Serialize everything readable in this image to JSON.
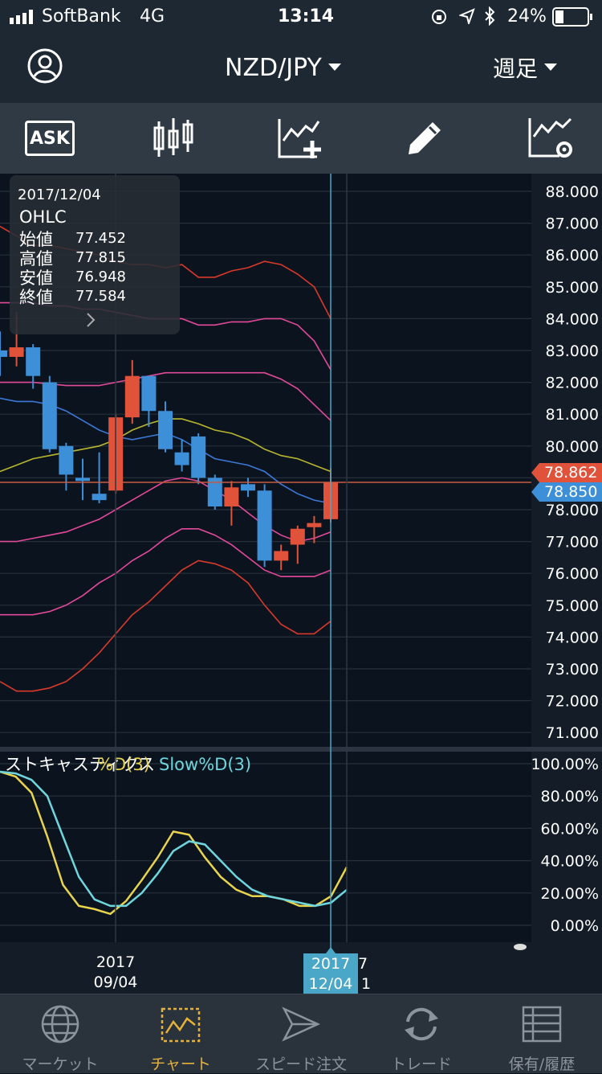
{
  "status_bar": {
    "carrier": "SoftBank",
    "network": "4G",
    "time": "13:14",
    "battery": "24%"
  },
  "header": {
    "pair": "NZD/JPY",
    "timeframe": "週足",
    "profile_icon": "user-circle-icon"
  },
  "toolbar": {
    "ask_label": "ASK",
    "icons": [
      "candlestick-icon",
      "add-indicator-icon",
      "pencil-icon",
      "indicator-settings-icon"
    ]
  },
  "ohlc_panel": {
    "date": "2017/12/04",
    "heading": "OHLC",
    "rows": [
      {
        "label": "始値",
        "value": "77.452"
      },
      {
        "label": "高値",
        "value": "77.815"
      },
      {
        "label": "安値",
        "value": "76.948"
      },
      {
        "label": "終値",
        "value": "77.584"
      }
    ]
  },
  "price_axis": [
    "88.000",
    "87.000",
    "86.000",
    "85.000",
    "84.000",
    "83.000",
    "82.000",
    "81.000",
    "80.000",
    "79.000",
    "78.000",
    "77.000",
    "76.000",
    "75.000",
    "74.000",
    "73.000",
    "72.000",
    "71.000"
  ],
  "price_tags": {
    "bid": "78.862",
    "ask": "78.850",
    "bid_color": "#e0523a",
    "ask_color": "#3d8fd8"
  },
  "stochastic": {
    "title": "ストキャスティクス",
    "d_label": "%D(3)",
    "slow_label": "Slow%D(3)",
    "axis": [
      "100.00%",
      "80.00%",
      "60.00%",
      "40.00%",
      "20.00%",
      "0.00%"
    ],
    "d_color": "#e8d44d",
    "slow_color": "#6fd6de"
  },
  "time_axis": {
    "label1_year": "2017",
    "label1_date": "09/04",
    "sel_year": "2017",
    "sel_date": "12/04",
    "peek_top": "7",
    "peek_bottom": "1"
  },
  "chart_data": [
    {
      "type": "candlestick",
      "ylim": [
        70.5,
        88.5
      ],
      "candles": [
        {
          "o": 83.0,
          "h": 83.6,
          "l": 82.2,
          "c": 82.8
        },
        {
          "o": 82.8,
          "h": 84.2,
          "l": 82.5,
          "c": 83.1
        },
        {
          "o": 83.1,
          "h": 83.2,
          "l": 81.8,
          "c": 82.2
        },
        {
          "o": 82.0,
          "h": 82.2,
          "l": 79.8,
          "c": 79.9
        },
        {
          "o": 80.0,
          "h": 80.1,
          "l": 78.6,
          "c": 79.1
        },
        {
          "o": 79.0,
          "h": 79.6,
          "l": 78.3,
          "c": 78.9
        },
        {
          "o": 78.5,
          "h": 79.8,
          "l": 78.2,
          "c": 78.3
        },
        {
          "o": 78.6,
          "h": 81.0,
          "l": 78.5,
          "c": 80.9
        },
        {
          "o": 80.9,
          "h": 82.7,
          "l": 80.7,
          "c": 82.2
        },
        {
          "o": 82.2,
          "h": 82.2,
          "l": 80.6,
          "c": 81.1
        },
        {
          "o": 81.1,
          "h": 81.4,
          "l": 79.8,
          "c": 79.9
        },
        {
          "o": 79.8,
          "h": 80.2,
          "l": 79.2,
          "c": 79.4
        },
        {
          "o": 80.3,
          "h": 80.4,
          "l": 78.8,
          "c": 79.0
        },
        {
          "o": 79.0,
          "h": 79.1,
          "l": 78.0,
          "c": 78.1
        },
        {
          "o": 78.1,
          "h": 78.9,
          "l": 77.5,
          "c": 78.7
        },
        {
          "o": 78.8,
          "h": 79.0,
          "l": 78.4,
          "c": 78.6
        },
        {
          "o": 78.6,
          "h": 78.8,
          "l": 76.2,
          "c": 76.4
        },
        {
          "o": 76.4,
          "h": 76.9,
          "l": 76.1,
          "c": 76.7
        },
        {
          "o": 76.9,
          "h": 77.5,
          "l": 76.3,
          "c": 77.4
        },
        {
          "o": 77.45,
          "h": 77.8,
          "l": 76.95,
          "c": 77.58
        },
        {
          "o": 77.7,
          "h": 79.3,
          "l": 77.6,
          "c": 78.86
        }
      ],
      "bands": {
        "outer_upper": [
          86.9,
          86.6,
          86.3,
          86.3,
          86.2,
          86.1,
          86.0,
          85.8,
          85.7,
          85.7,
          85.6,
          85.7,
          85.3,
          85.3,
          85.5,
          85.6,
          85.8,
          85.7,
          85.4,
          85.0,
          84.0
        ],
        "inner_upper": [
          84.5,
          84.5,
          84.5,
          84.4,
          84.4,
          84.3,
          84.3,
          84.2,
          84.1,
          84.0,
          84.0,
          84.0,
          83.8,
          83.8,
          83.9,
          83.9,
          84.0,
          84.0,
          83.8,
          83.3,
          82.4
        ],
        "upper": [
          82.0,
          82.0,
          82.0,
          81.95,
          81.9,
          81.9,
          81.9,
          82.0,
          82.1,
          82.2,
          82.3,
          82.3,
          82.3,
          82.3,
          82.3,
          82.3,
          82.3,
          82.1,
          81.8,
          81.3,
          80.8
        ],
        "moving_avg": [
          81.5,
          81.4,
          81.4,
          81.3,
          81.1,
          80.8,
          80.5,
          80.3,
          80.2,
          80.3,
          80.4,
          80.2,
          79.9,
          79.6,
          79.5,
          79.4,
          79.2,
          78.8,
          78.5,
          78.3,
          78.2
        ],
        "middle": [
          79.2,
          79.4,
          79.6,
          79.7,
          79.8,
          79.9,
          80.0,
          80.2,
          80.5,
          80.7,
          80.85,
          80.85,
          80.7,
          80.5,
          80.4,
          80.2,
          79.9,
          79.7,
          79.6,
          79.4,
          79.2
        ],
        "lower": [
          77.0,
          77.0,
          77.1,
          77.2,
          77.3,
          77.5,
          77.7,
          78.0,
          78.3,
          78.6,
          78.9,
          79.0,
          78.9,
          78.6,
          78.3,
          77.9,
          77.5,
          77.2,
          77.0,
          77.1,
          77.3
        ],
        "inner_lower": [
          74.7,
          74.7,
          74.7,
          74.8,
          75.0,
          75.3,
          75.7,
          76.0,
          76.4,
          76.7,
          77.1,
          77.4,
          77.4,
          77.2,
          76.9,
          76.5,
          76.1,
          75.9,
          75.9,
          75.9,
          76.1
        ],
        "outer_lower": [
          72.6,
          72.3,
          72.3,
          72.4,
          72.6,
          73.0,
          73.5,
          74.1,
          74.7,
          75.1,
          75.6,
          76.1,
          76.4,
          76.3,
          76.1,
          75.7,
          75.0,
          74.4,
          74.1,
          74.1,
          74.5
        ]
      }
    },
    {
      "type": "line",
      "ylim": [
        0,
        100
      ],
      "series": [
        {
          "name": "%D(3)",
          "values": [
            95,
            92,
            82,
            55,
            25,
            12,
            10,
            7,
            15,
            28,
            42,
            58,
            56,
            42,
            30,
            22,
            18,
            18,
            16,
            12,
            12,
            18,
            36
          ]
        },
        {
          "name": "Slow%D(3)",
          "values": [
            95,
            94,
            90,
            80,
            55,
            30,
            16,
            12,
            12,
            20,
            32,
            46,
            52,
            50,
            40,
            30,
            22,
            18,
            16,
            14,
            12,
            14,
            22
          ]
        }
      ]
    }
  ]
}
